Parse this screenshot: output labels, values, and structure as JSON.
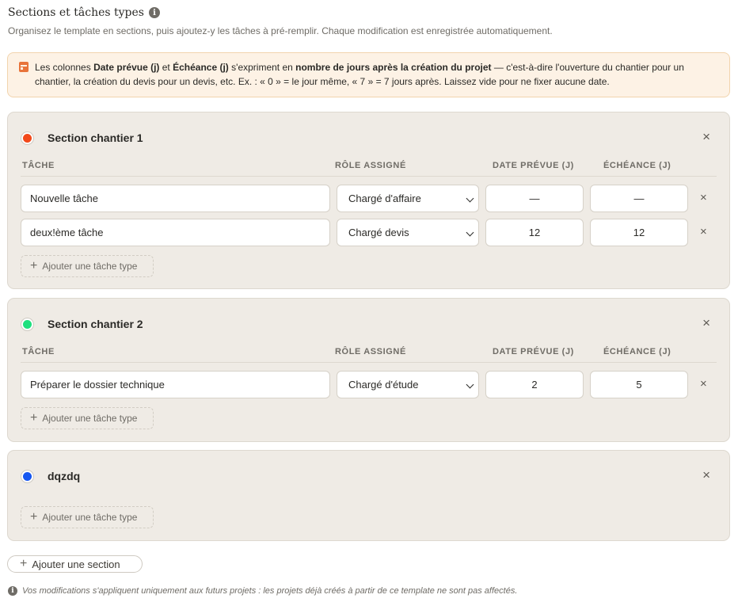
{
  "header": {
    "title": "Sections et tâches types",
    "subtitle": "Organisez le template en sections, puis ajoutez-y les tâches à pré-remplir. Chaque modification est enregistrée automatiquement."
  },
  "notice": {
    "p1": "Les colonnes ",
    "b1": "Date prévue (j)",
    "p2": " et ",
    "b2": "Échéance (j)",
    "p3": " s'expriment en ",
    "b3": "nombre de jours après la création du projet",
    "p4": " — c'est-à-dire l'ouverture du chantier pour un chantier, la création du devis pour un devis, etc. Ex. : « 0 » = le jour même, « 7 » = 7 jours après. Laissez vide pour ne fixer aucune date."
  },
  "columns": {
    "task": "TÂCHE",
    "role": "RÔLE ASSIGNÉ",
    "date": "DATE PRÉVUE (J)",
    "due": "ÉCHÉANCE (J)"
  },
  "sections": [
    {
      "title": "Section chantier 1",
      "color": "#f2491a",
      "tasks": [
        {
          "name": "Nouvelle tâche",
          "role": "Chargé d'affaire",
          "date": "—",
          "due": "—"
        },
        {
          "name": "deux!ème tâche",
          "role": "Chargé devis",
          "date": "12",
          "due": "12"
        }
      ]
    },
    {
      "title": "Section chantier 2",
      "color": "#1fe07e",
      "tasks": [
        {
          "name": "Préparer le dossier technique",
          "role": "Chargé d'étude",
          "date": "2",
          "due": "5"
        }
      ]
    },
    {
      "title": "dqzdq",
      "color": "#1556f0",
      "tasks": []
    }
  ],
  "actions": {
    "add_task": "Ajouter une tâche type",
    "add_section": "Ajouter une section",
    "close_glyph": "×",
    "plus_glyph": "+"
  },
  "footnote": "Vos modifications s'appliquent uniquement aux futurs projets : les projets déjà créés à partir de ce template ne sont pas affectés.",
  "icons": {
    "info": "info-icon",
    "calendar": "calendar-icon",
    "close": "close-icon",
    "chevron": "chevron-down-icon",
    "plus": "plus-icon"
  }
}
